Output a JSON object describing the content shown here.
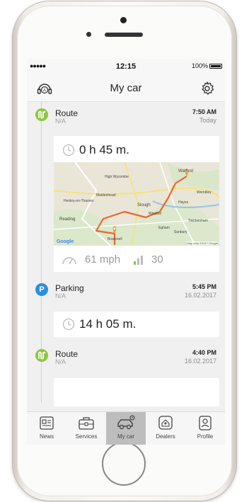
{
  "status_bar": {
    "signal": "●●●●● ",
    "time": "12:15",
    "battery": "100%"
  },
  "header": {
    "title": "My car"
  },
  "events": [
    {
      "type": "Route",
      "badge": "N",
      "sub": "N/A",
      "time": "7:50 AM",
      "date": "Today"
    },
    {
      "type": "Parking",
      "badge": "P",
      "sub": "N/A",
      "time": "5:45 PM",
      "date": "16.02.2017"
    },
    {
      "type": "Route",
      "badge": "N",
      "sub": "N/A",
      "time": "4:40 PM",
      "date": "16.02.2017"
    }
  ],
  "cards": [
    {
      "duration": "0 h 45 m.",
      "speed": "61 mph",
      "signal_value": "30"
    },
    {
      "duration": "14 h 05 m."
    }
  ],
  "map": {
    "labels": [
      "Watford",
      "Slough",
      "Reading",
      "Bracknell",
      "Hayes",
      "Twickenham",
      "Wembley",
      "Maidenhead",
      "High Wycombe",
      "Henley-on-Thames",
      "Windsor",
      "Sunbury",
      "Egham"
    ],
    "google": "Google",
    "footer": "Map data ©2017 Google"
  },
  "tabs": [
    {
      "label": "News",
      "icon": "news-icon"
    },
    {
      "label": "Services",
      "icon": "briefcase-icon"
    },
    {
      "label": "My car",
      "icon": "car-icon"
    },
    {
      "label": "Dealers",
      "icon": "dealer-icon"
    },
    {
      "label": "Profile",
      "icon": "profile-icon"
    }
  ],
  "colors": {
    "route_green": "#8dc63f",
    "parking_blue": "#2b8fe0",
    "route_line": "#e8692a",
    "active_tab": "#bdbdbd"
  }
}
